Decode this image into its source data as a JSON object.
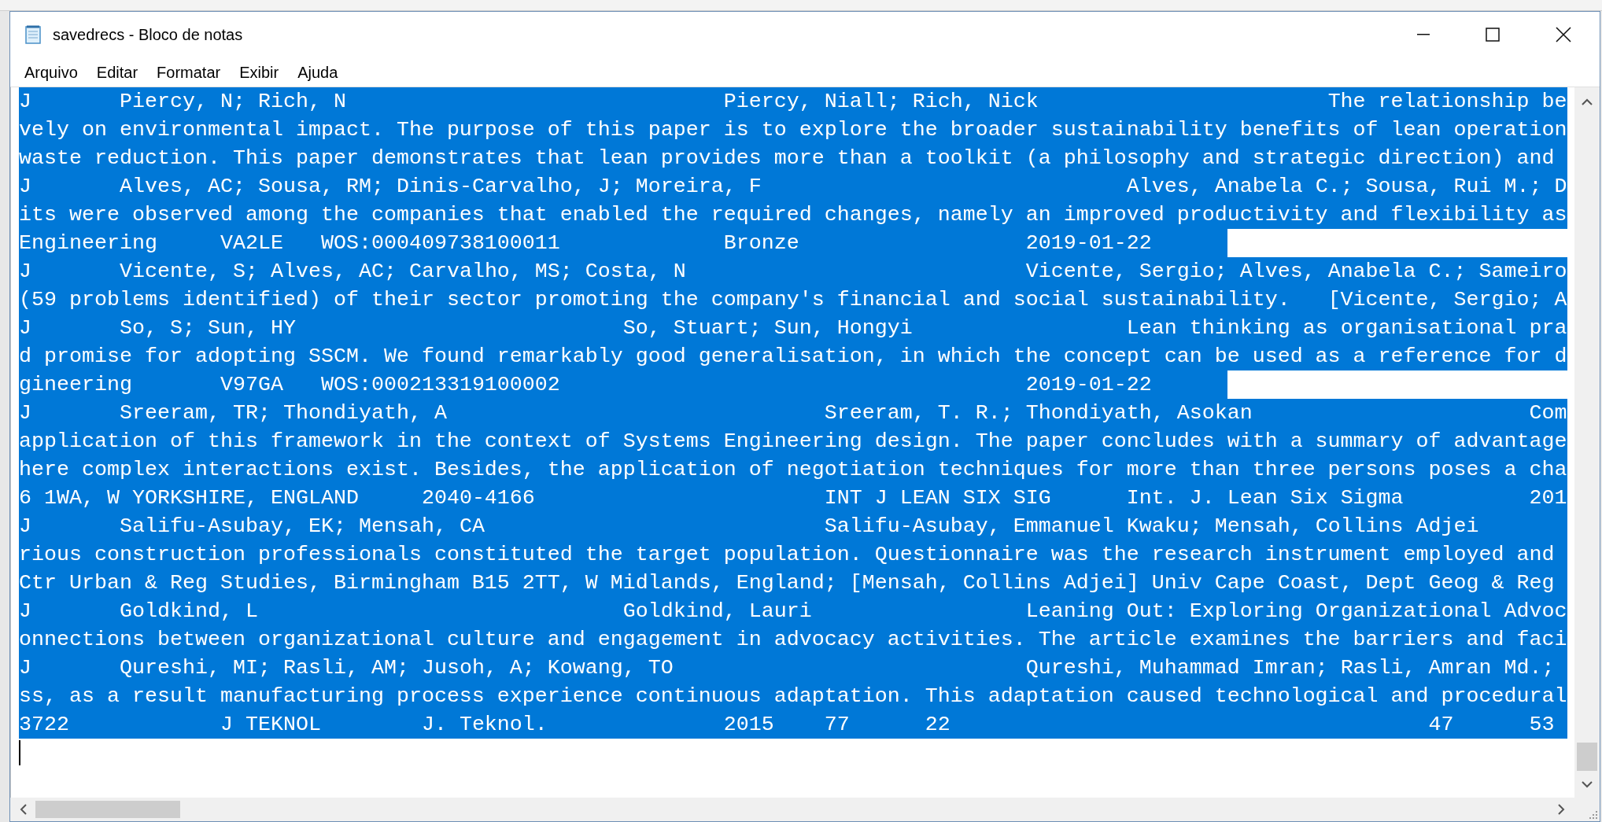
{
  "window": {
    "title": "savedrecs - Bloco de notas"
  },
  "menu": [
    "Arquivo",
    "Editar",
    "Formatar",
    "Exibir",
    "Ajuda"
  ],
  "editor": {
    "lines": [
      {
        "text": "J\tPiercy, N; Rich, N\t\t\t\tPiercy, Niall; Rich, Nick\t\t\tThe relationship be",
        "selected": true,
        "caret": false
      },
      {
        "text": "vely on environmental impact. The purpose of this paper is to explore the broader sustainability benefits of lean operation",
        "selected": true,
        "caret": false
      },
      {
        "text": "waste reduction. This paper demonstrates that lean provides more than a toolkit (a philosophy and strategic direction) and ",
        "selected": true,
        "caret": false
      },
      {
        "text": "J\tAlves, AC; Sousa, RM; Dinis-Carvalho, J; Moreira, F\t\t\t\tAlves, Anabela C.; Sousa, Rui M.; D",
        "selected": true,
        "caret": false
      },
      {
        "text": "its were observed among the companies that enabled the required changes, namely an improved productivity and flexibility as",
        "selected": true,
        "caret": false
      },
      {
        "text": "Engineering\tVA2LE\tWOS:000409738100011\t\tBronze\t\t\t2019-01-22\t",
        "selected": true,
        "caret": false
      },
      {
        "text": "J\tVicente, S; Alves, AC; Carvalho, MS; Costa, N\t\t\t\tVicente, Sergio; Alves, Anabela C.; Sameiro",
        "selected": true,
        "caret": false
      },
      {
        "text": "(59 problems identified) of their sector promoting the company's financial and social sustainability.\t[Vicente, Sergio; A",
        "selected": true,
        "caret": false
      },
      {
        "text": "J\tSo, S; Sun, HY\t\t\t\tSo, Stuart; Sun, Hongyi\t\t\tLean thinking as organisational pra",
        "selected": true,
        "caret": false
      },
      {
        "text": "d promise for adopting SSCM. We found remarkably good generalisation, in which the concept can be used as a reference for d",
        "selected": true,
        "caret": false
      },
      {
        "text": "gineering\tV97GA\tWOS:000213319100002\t\t\t\t\t2019-01-22\t",
        "selected": true,
        "caret": false
      },
      {
        "text": "J\tSreeram, TR; Thondiyath, A\t\t\t\tSreeram, T. R.; Thondiyath, Asokan\t\t\tCom",
        "selected": true,
        "caret": false
      },
      {
        "text": "application of this framework in the context of Systems Engineering design. The paper concludes with a summary of advantage",
        "selected": true,
        "caret": false
      },
      {
        "text": "here complex interactions exist. Besides, the application of negotiation techniques for more than three persons poses a cha",
        "selected": true,
        "caret": false
      },
      {
        "text": "6 1WA, W YORKSHIRE, ENGLAND\t2040-4166\t\t\tINT J LEAN SIX SIG\tInt. J. Lean Six Sigma\t\t201",
        "selected": true,
        "caret": false
      },
      {
        "text": "J\tSalifu-Asubay, EK; Mensah, CA\t\t\t\tSalifu-Asubay, Emmanuel Kwaku; Mensah, Collins Adjei\t   ",
        "selected": true,
        "caret": false
      },
      {
        "text": "rious construction professionals constituted the target population. Questionnaire was the research instrument employed and ",
        "selected": true,
        "caret": false
      },
      {
        "text": "Ctr Urban & Reg Studies, Birmingham B15 2TT, W Midlands, England; [Mensah, Collins Adjei] Univ Cape Coast, Dept Geog & Reg ",
        "selected": true,
        "caret": false
      },
      {
        "text": "J\tGoldkind, L\t\t\t\tGoldkind, Lauri\t\t\tLeaning Out: Exploring Organizational Advoc",
        "selected": true,
        "caret": false
      },
      {
        "text": "onnections between organizational culture and engagement in advocacy activities. The article examines the barriers and faci",
        "selected": true,
        "caret": false
      },
      {
        "text": "J\tQureshi, MI; Rasli, AM; Jusoh, A; Kowang, TO\t\t\t\tQureshi, Muhammad Imran; Rasli, Amran Md.; ",
        "selected": true,
        "caret": false
      },
      {
        "text": "ss, as a result manufacturing process experience continuous adaptation. This adaptation caused technological and procedural",
        "selected": true,
        "caret": false
      },
      {
        "text": "3722\t\tJ TEKNOL\tJ. Teknol.\t\t2015\t77\t22\t\t\t\t\t47\t53 ",
        "selected": true,
        "caret": false
      },
      {
        "selected": false,
        "caret": true
      }
    ]
  }
}
